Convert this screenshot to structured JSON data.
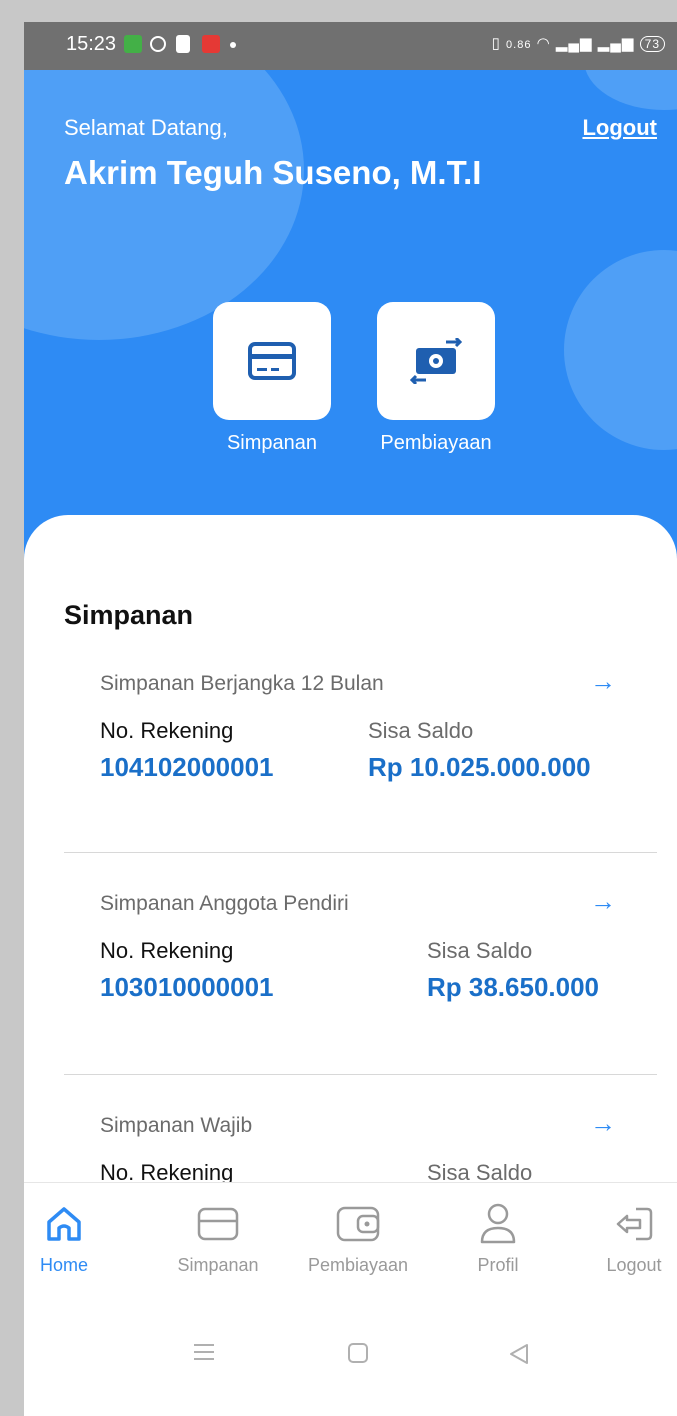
{
  "status_bar": {
    "time": "15:23",
    "net_speed": "0.86",
    "battery": "73"
  },
  "header": {
    "greeting": "Selamat Datang,",
    "user_name": "Akrim Teguh Suseno, M.T.I",
    "logout_label": "Logout",
    "bg_color": "#2e8bf4"
  },
  "quick_actions": [
    {
      "label": "Simpanan",
      "icon": "card-icon"
    },
    {
      "label": "Pembiayaan",
      "icon": "money-exchange-icon"
    }
  ],
  "section": {
    "title": "Simpanan"
  },
  "accounts": [
    {
      "name": "Simpanan Berjangka 12 Bulan",
      "no_label": "No. Rekening",
      "no": "104102000001",
      "saldo_label": "Sisa Saldo",
      "saldo": "Rp 10.025.000.000"
    },
    {
      "name": "Simpanan Anggota Pendiri",
      "no_label": "No. Rekening",
      "no": "103010000001",
      "saldo_label": "Sisa Saldo",
      "saldo": "Rp 38.650.000"
    },
    {
      "name": "Simpanan Wajib",
      "no_label": "No. Rekening",
      "no": "",
      "saldo_label": "Sisa Saldo",
      "saldo": ""
    }
  ],
  "bottom_nav": [
    {
      "label": "Home",
      "icon": "home-icon",
      "active": true
    },
    {
      "label": "Simpanan",
      "icon": "card-icon",
      "active": false
    },
    {
      "label": "Pembiayaan",
      "icon": "wallet-icon",
      "active": false
    },
    {
      "label": "Profil",
      "icon": "user-icon",
      "active": false
    },
    {
      "label": "Logout",
      "icon": "logout-icon",
      "active": false
    }
  ],
  "colors": {
    "accent": "#2e8bf4",
    "value_blue": "#1a6fc8"
  }
}
